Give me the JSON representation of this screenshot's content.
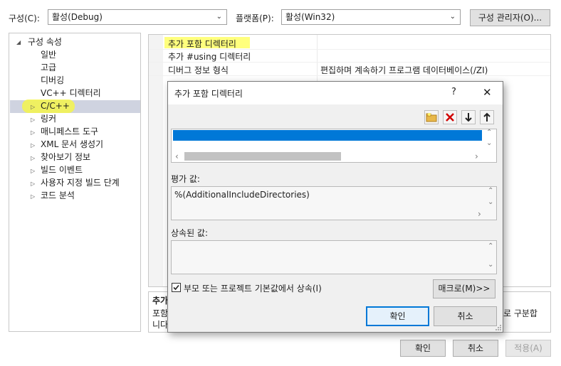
{
  "top": {
    "config_label": "구성(C):",
    "config_value": "활성(Debug)",
    "platform_label": "플랫폼(P):",
    "platform_value": "활성(Win32)",
    "config_manager_button": "구성 관리자(O)..."
  },
  "tree": {
    "root": "구성 속성",
    "items": [
      "일반",
      "고급",
      "디버깅",
      "VC++ 디렉터리",
      "C/C++",
      "링커",
      "매니페스트 도구",
      "XML 문서 생성기",
      "찾아보기 정보",
      "빌드 이벤트",
      "사용자 지정 빌드 단계",
      "코드 분석"
    ],
    "selected": "C/C++"
  },
  "grid": {
    "rows": [
      {
        "name": "추가 포함 디렉터리",
        "value": ""
      },
      {
        "name": "추가 #using 디렉터리",
        "value": ""
      },
      {
        "name": "디버그 정보 형식",
        "value": "편집하며 계속하기 프로그램 데이터베이스(/ZI)"
      }
    ]
  },
  "description": {
    "title": "추가",
    "line1": "포함",
    "line1_right": "로 구분합",
    "line2": "니다"
  },
  "dialog": {
    "title": "추가 포함 디렉터리",
    "help": "?",
    "close": "✕",
    "evaluated_label": "평가 값:",
    "evaluated_value": "%(AdditionalIncludeDirectories)",
    "inherited_label": "상속된 값:",
    "inherit_checkbox_label": "부모 또는 프로젝트 기본값에서 상속(I)",
    "inherit_checked": true,
    "macro_button": "매크로(M)>>",
    "ok_button": "확인",
    "cancel_button": "취소"
  },
  "footer": {
    "ok": "확인",
    "cancel": "취소",
    "apply": "적용(A)"
  },
  "colors": {
    "selection_blue": "#0078d7",
    "highlighter_yellow": "#ffff66",
    "tree_selection": "#cfd3e0",
    "delete_red": "#d00000",
    "folder_yellow": "#e8b84a"
  }
}
